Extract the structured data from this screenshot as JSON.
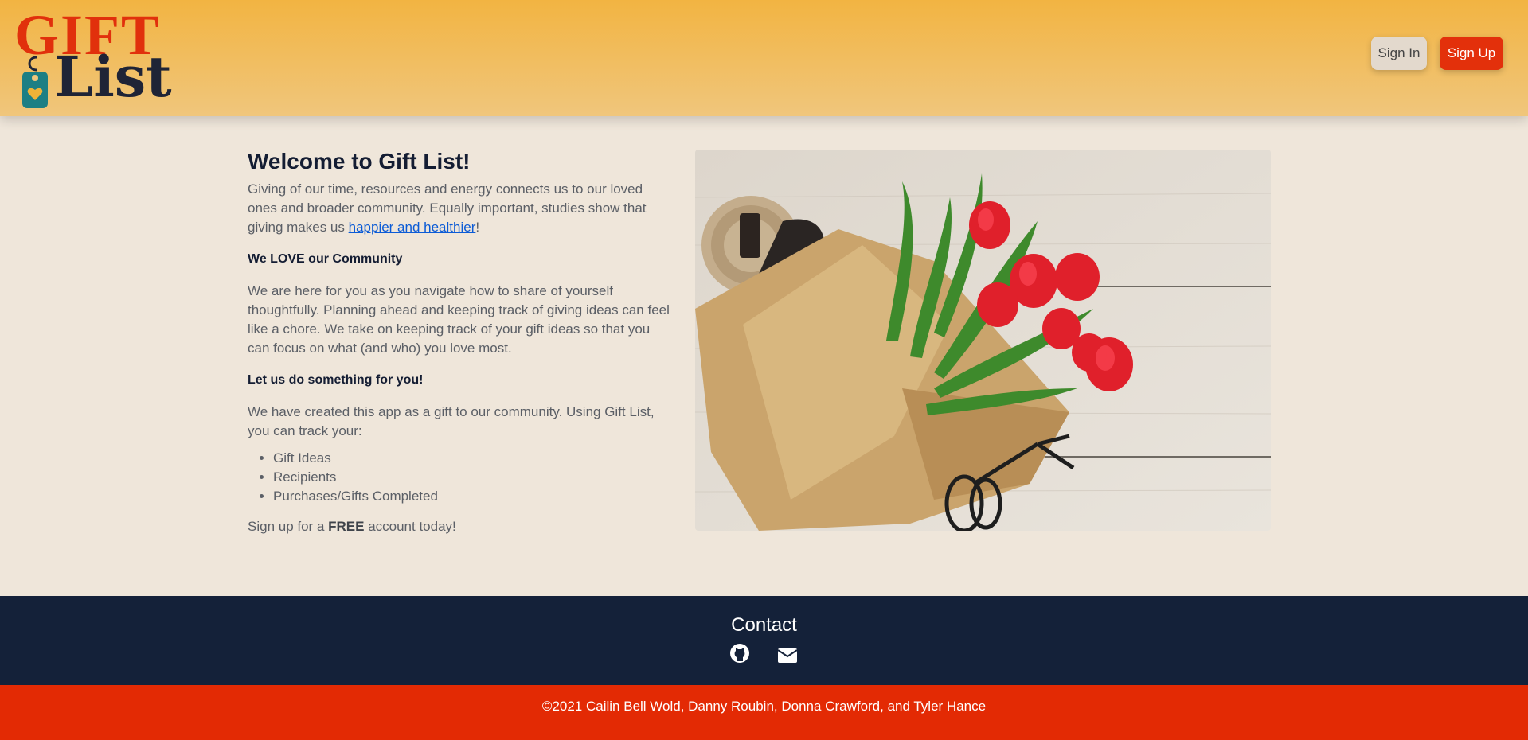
{
  "header": {
    "logo": {
      "word_top": "GIFT",
      "word_bottom": "List"
    },
    "signin_label": "Sign In",
    "signup_label": "Sign Up"
  },
  "main": {
    "title": "Welcome to Gift List!",
    "intro_text": "Giving of our time, resources and energy connects us to our loved ones and broader community. Equally important, studies show that giving makes us ",
    "intro_link": "happier and healthier",
    "intro_end": "!",
    "community_heading": "We LOVE our Community",
    "community_text": "We are here for you as you navigate how to share of yourself thoughtfully. Planning ahead and keeping track of giving ideas can feel like a chore. We take on keeping track of your gift ideas so that you can focus on what (and who) you love most.",
    "help_heading": "Let us do something for you!",
    "app_text": "We have created this app as a gift to our community. Using Gift List, you can track your:",
    "track_items": [
      "Gift Ideas",
      "Recipients",
      "Purchases/Gifts Completed"
    ],
    "signup_prefix": "Sign up for a ",
    "signup_bold": "FREE",
    "signup_suffix": " account today!"
  },
  "footer": {
    "contact_title": "Contact",
    "icons": [
      "github-icon",
      "envelope-icon"
    ],
    "copyright": "©2021 Cailin Bell Wold, Danny Roubin, Donna Crawford, and Tyler Hance"
  },
  "colors": {
    "header_top": "#f2b442",
    "header_bottom": "#f0c67c",
    "background": "#efe6da",
    "navy": "#142139",
    "red": "#e32a04",
    "link": "#0b5bd6"
  }
}
